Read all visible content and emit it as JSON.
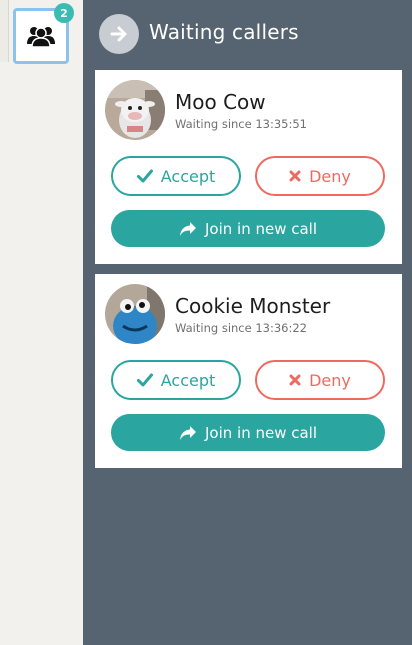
{
  "notifications": {
    "badge_count": "2",
    "icon": "group-icon"
  },
  "header": {
    "title": "Waiting callers",
    "collapse_icon": "arrow-right-icon"
  },
  "callers": [
    {
      "name": "Moo Cow",
      "waiting_since": "Waiting since 13:35:51",
      "accept_label": "Accept",
      "deny_label": "Deny",
      "join_label": "Join in new call"
    },
    {
      "name": "Cookie Monster",
      "waiting_since": "Waiting since 13:36:22",
      "accept_label": "Accept",
      "deny_label": "Deny",
      "join_label": "Join in new call"
    }
  ],
  "colors": {
    "panel_bg": "#566370",
    "accept": "#2aa5a0",
    "deny": "#ee6a61",
    "badge": "#3cbab4"
  }
}
